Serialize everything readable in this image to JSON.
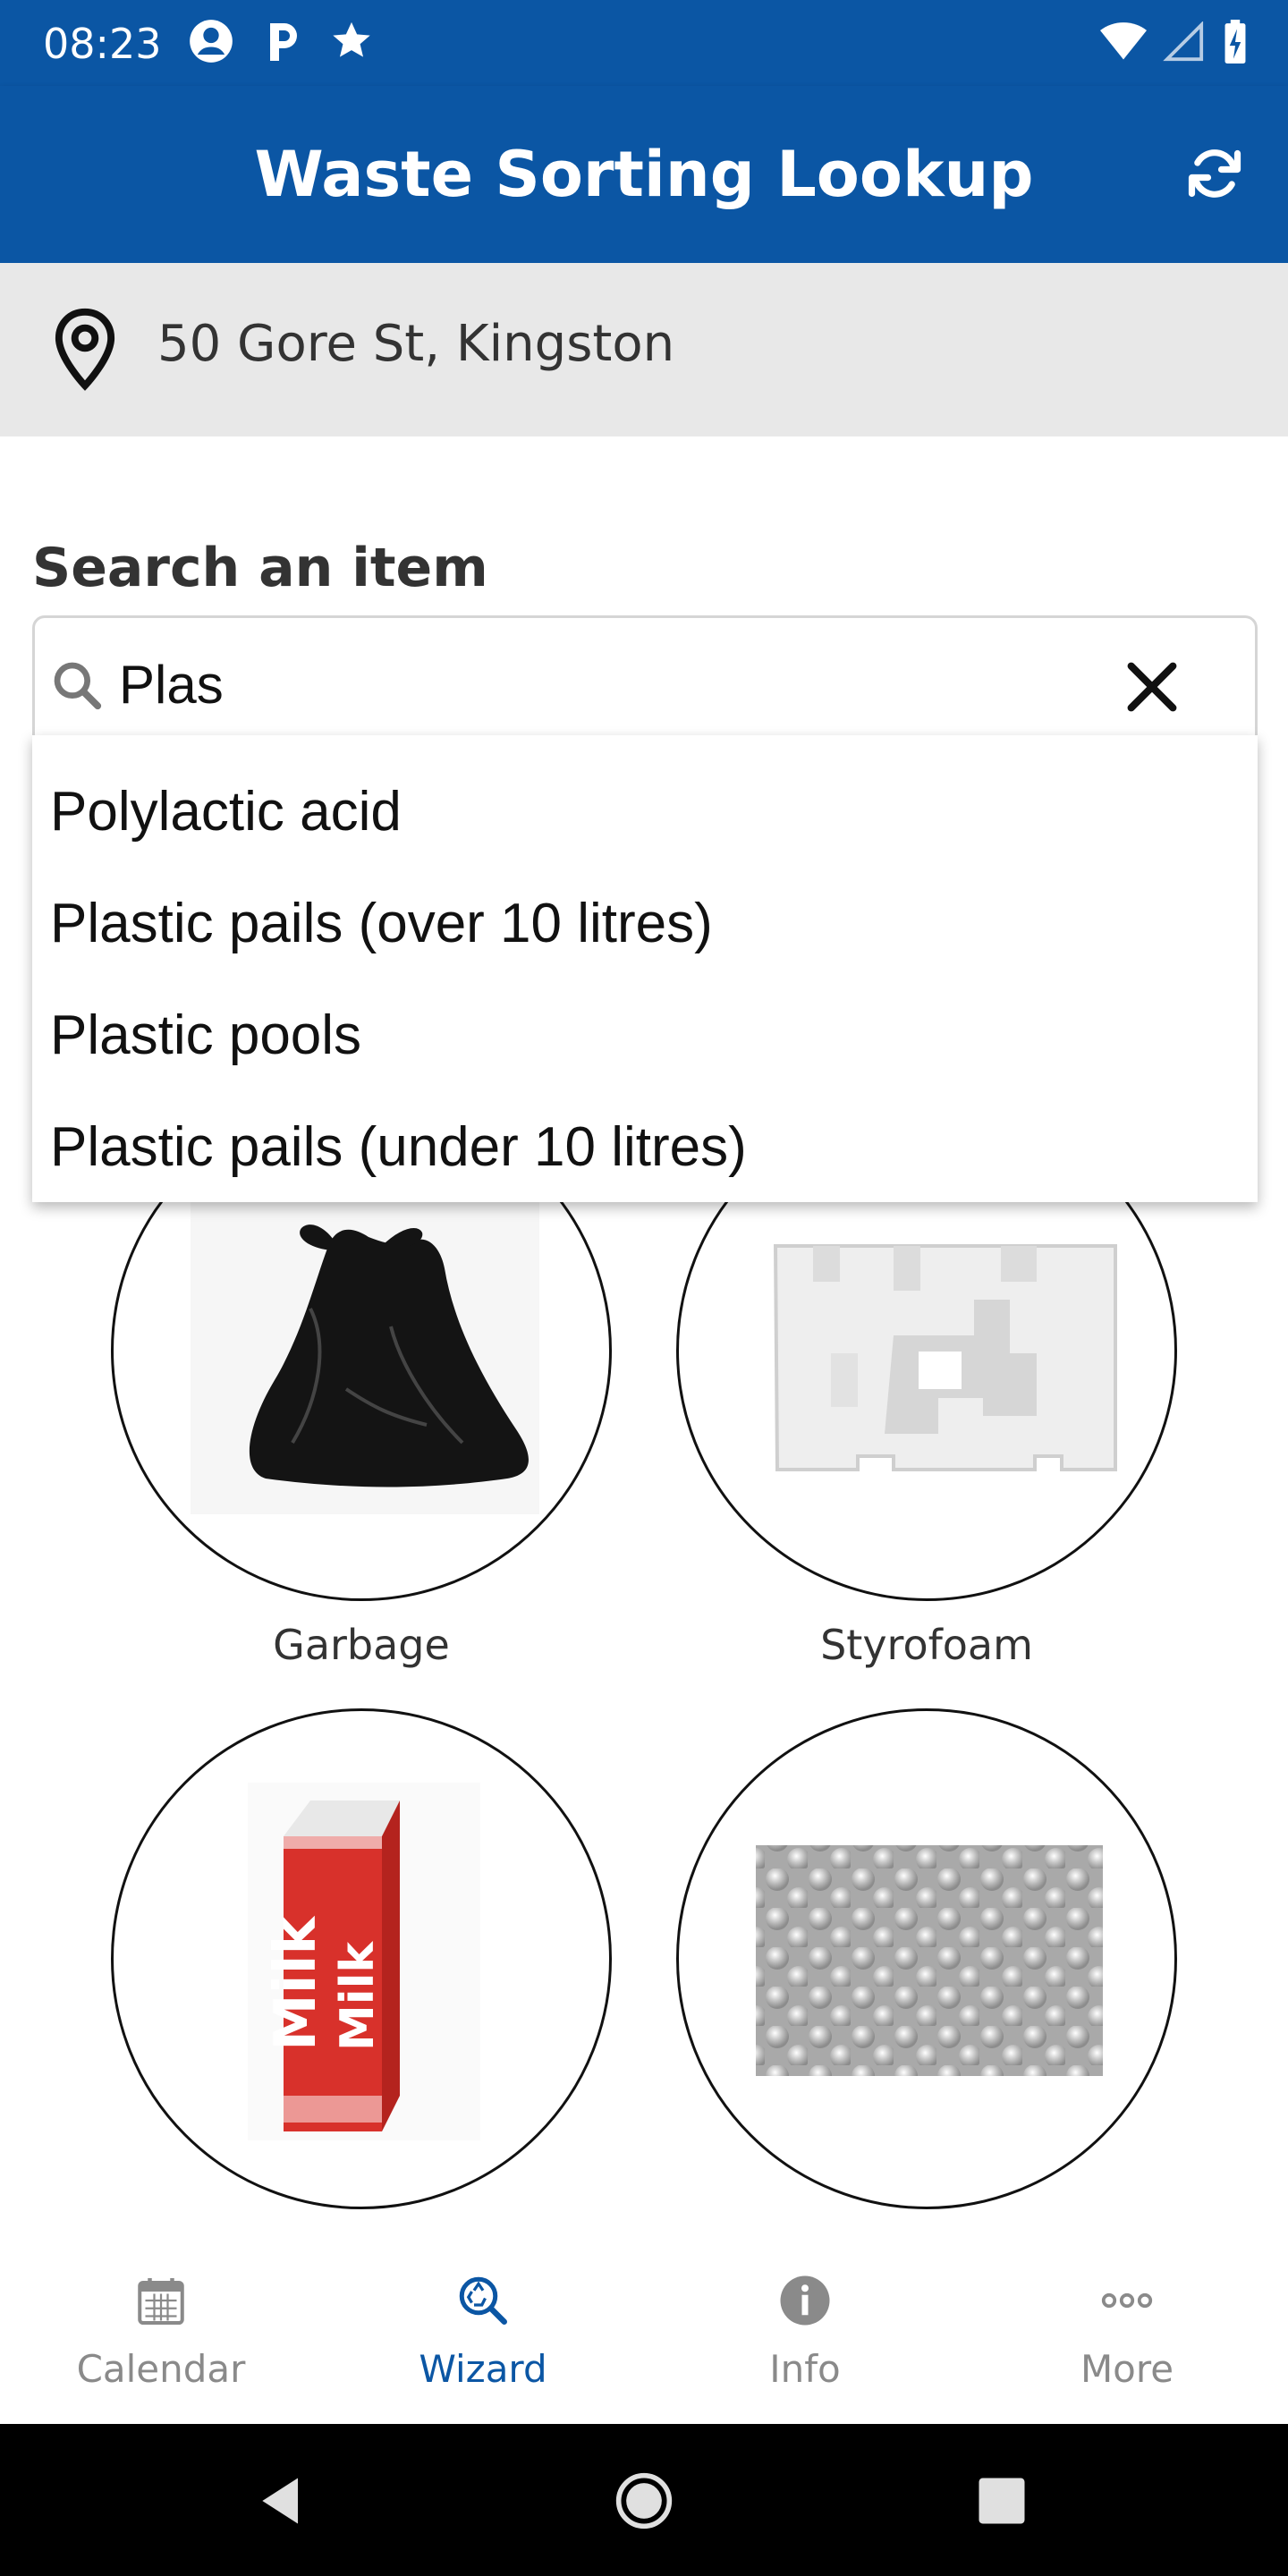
{
  "status_bar": {
    "time": "08:23",
    "icons_left": [
      "account-circle-icon",
      "parking-icon",
      "star-icon"
    ],
    "icons_right": [
      "wifi-icon",
      "signal-icon",
      "battery-charging-icon"
    ]
  },
  "app_bar": {
    "title": "Waste Sorting Lookup",
    "refresh_icon": "refresh-icon",
    "color": "#0b56a4"
  },
  "location": {
    "icon": "location-pin-icon",
    "address": "50 Gore St, Kingston"
  },
  "search": {
    "label": "Search an item",
    "value": "Plas",
    "icon": "search-icon",
    "clear_icon": "close-icon"
  },
  "suggestions": [
    "Polylactic acid",
    "Plastic pails (over 10 litres)",
    "Plastic pools",
    "Plastic pails (under 10 litres)"
  ],
  "categories": [
    {
      "label": "Garbage",
      "image": "garbage-bag"
    },
    {
      "label": "Styrofoam",
      "image": "styrofoam-packaging"
    },
    {
      "label": "",
      "image": "milk-carton"
    },
    {
      "label": "",
      "image": "bubble-wrap"
    }
  ],
  "bottom_nav": {
    "items": [
      {
        "label": "Calendar",
        "icon": "calendar-icon",
        "active": false
      },
      {
        "label": "Wizard",
        "icon": "recycle-search-icon",
        "active": true
      },
      {
        "label": "Info",
        "icon": "info-icon",
        "active": false
      },
      {
        "label": "More",
        "icon": "more-dots-icon",
        "active": false
      }
    ],
    "active_color": "#0b56a4",
    "inactive_color": "#8a8a8a"
  },
  "system_nav": {
    "icons": [
      "back-icon",
      "home-icon",
      "recents-icon"
    ]
  }
}
